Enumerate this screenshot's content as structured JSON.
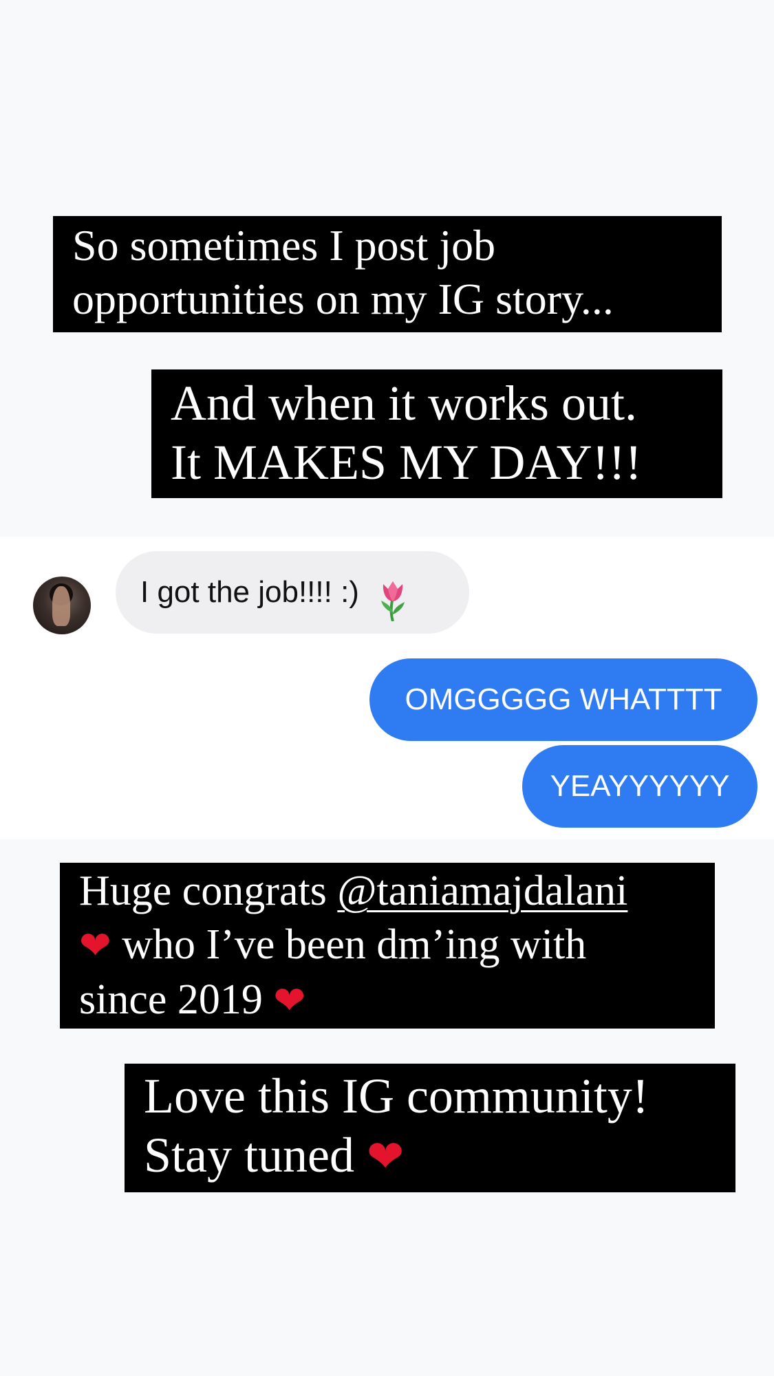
{
  "captions": {
    "intro": {
      "line1": "So sometimes I post job",
      "line2": "opportunities on my IG story..."
    },
    "works_out": {
      "line1": "And when it works out.",
      "line2": "It MAKES MY DAY!!!"
    },
    "congrats": {
      "line1_prefix": "Huge congrats ",
      "mention": "@taniamajdalani",
      "line2": "who I’ve been dm’ing with",
      "line3": "since 2019"
    },
    "community": {
      "line1": "Love this IG community!",
      "line2": "Stay tuned"
    }
  },
  "icons": {
    "heart": "❤",
    "tulip": "tulip-emoji"
  },
  "messages": {
    "incoming": {
      "text": "I got the job!!!! :)"
    },
    "outgoing": [
      {
        "text": "OMGGGGG WHATTTT"
      },
      {
        "text": "YEAYYYYYY"
      }
    ]
  },
  "colors": {
    "caption_bg": "#000000",
    "caption_text": "#ffffff",
    "outgoing_bubble": "#2f7cf2",
    "incoming_bubble": "#efeff1",
    "heart": "#e3142c"
  }
}
